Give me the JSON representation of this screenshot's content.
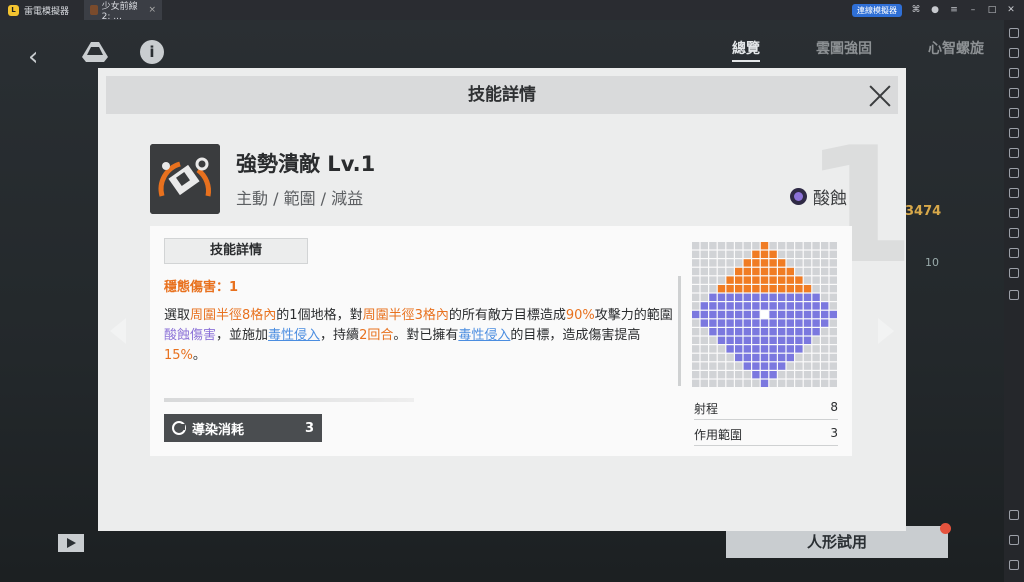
{
  "window": {
    "app_name": "雷電模擬器",
    "tab_title": "少女前線2: ...",
    "tab_close": "×",
    "top_button": "連線模擬器"
  },
  "background": {
    "tabs": [
      "總覽",
      "雲圖強固",
      "心智螺旋"
    ],
    "number_right": "3474",
    "number_small": "10",
    "try_button": "人形試用"
  },
  "modal": {
    "title": "技能詳情",
    "big_level_digit": "1",
    "skill_name": "強勢潰敵 Lv.1",
    "skill_tags": "主動 / 範圍 / 減益",
    "element": "酸蝕",
    "detail_tab": "技能詳情",
    "stable_damage": "穩態傷害：1",
    "description": {
      "p1": "選取",
      "p2": "周圍半徑8格內",
      "p3": "的1個地格，對",
      "p4": "周圍半徑3格內",
      "p5": "的所有敵方目標造成",
      "p6": "90%",
      "p7": "攻擊力的範圍",
      "p8": "酸蝕傷害",
      "p9": "，並施加",
      "p10": "毒性侵入",
      "p11": "，持續",
      "p12": "2回合",
      "p13": "。對已擁有",
      "p14": "毒性侵入",
      "p15": "的目標，造成傷害提高",
      "p16": "15%",
      "p17": "。"
    },
    "cost_label": "導染消耗",
    "cost_value": "3",
    "stats": [
      {
        "label": "射程",
        "value": "8"
      },
      {
        "label": "作用範圍",
        "value": "3"
      }
    ]
  },
  "colors": {
    "orange_cell": "#f07c24",
    "purple_cell": "#7b78df",
    "empty_cell": "#d1d3d6",
    "center_cell": "#ffffff"
  },
  "range_grid": {
    "size": 17,
    "range": 8,
    "area": 3
  }
}
